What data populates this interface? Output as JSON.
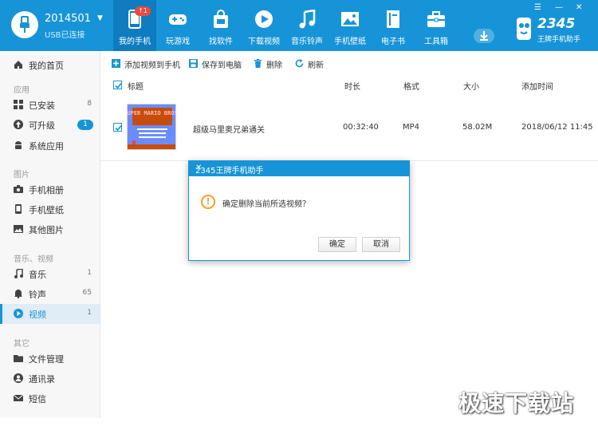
{
  "device": {
    "name": "2014501",
    "status": "USB已连接"
  },
  "nav": [
    {
      "label": "我的手机",
      "icon": "phone-icon",
      "badge": "↑1",
      "active": true
    },
    {
      "label": "玩游戏",
      "icon": "gamepad-icon"
    },
    {
      "label": "找软件",
      "icon": "store-bag-icon"
    },
    {
      "label": "下载视频",
      "icon": "play-circle-icon"
    },
    {
      "label": "音乐铃声",
      "icon": "music-note-icon"
    },
    {
      "label": "手机壁纸",
      "icon": "picture-icon"
    },
    {
      "label": "电子书",
      "icon": "book-icon"
    },
    {
      "label": "工具箱",
      "icon": "toolbox-icon"
    }
  ],
  "brand": {
    "number": "2345",
    "subtitle": "王牌手机助手"
  },
  "window_controls": {
    "skin": "☰",
    "min": "—",
    "close": "✕"
  },
  "sidebar": {
    "home": "我的首页",
    "sections": {
      "apps": "应用",
      "images": "图片",
      "media": "音乐、视频",
      "other": "其它"
    },
    "items": {
      "installed": {
        "label": "已安装",
        "count": "8"
      },
      "upgradable": {
        "label": "可升级",
        "count": "1"
      },
      "system": {
        "label": "系统应用"
      },
      "album": {
        "label": "手机相册"
      },
      "wallpaper": {
        "label": "手机壁纸"
      },
      "other_pics": {
        "label": "其他图片"
      },
      "music": {
        "label": "音乐",
        "count": "1"
      },
      "ringtone": {
        "label": "铃声",
        "count": "65"
      },
      "video": {
        "label": "视频",
        "count": "1"
      },
      "files": {
        "label": "文件管理"
      },
      "contacts": {
        "label": "通讯录"
      },
      "sms": {
        "label": "短信"
      }
    }
  },
  "toolbar": {
    "add": "添加视频到手机",
    "save": "保存到电脑",
    "delete": "删除",
    "refresh": "刷新"
  },
  "table": {
    "headers": {
      "title": "标题",
      "duration": "时长",
      "format": "格式",
      "size": "大小",
      "added": "添加时间"
    },
    "rows": [
      {
        "title": "超级马里奥兄弟通关",
        "duration": "00:32:40",
        "format": "MP4",
        "size": "58.02M",
        "added": "2018/06/12 11:45",
        "thumb_text": "SUPER MARIO BROS."
      }
    ]
  },
  "dialog": {
    "title": "2345王牌手机助手",
    "message": "确定删除当前所选视频？",
    "ok": "确定",
    "cancel": "取消"
  },
  "watermark": "极速下载站",
  "colors": {
    "accent": "#1794d8",
    "nav_active": "#0f7cc0",
    "badge": "#f0483e",
    "warning": "#f0a030"
  }
}
